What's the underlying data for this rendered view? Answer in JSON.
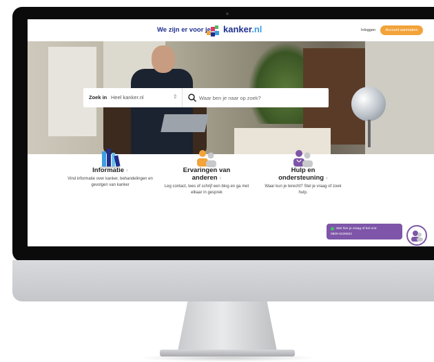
{
  "header": {
    "tagline": "We zijn er voor je…",
    "brand_name": "kanker",
    "brand_tld": ".nl",
    "login_label": "Inloggen",
    "account_label": "Account aanmaken"
  },
  "search": {
    "label": "Zoek in",
    "scope": "Heel kanker.nl",
    "placeholder": "Waar ben je naar op zoek?"
  },
  "features": [
    {
      "icon": "books-icon",
      "title": "Informatie",
      "title2": "",
      "description": "Vind informatie over kanker, behandelingen en gevolgen van kanker"
    },
    {
      "icon": "people-icon",
      "title": "Ervaringen van",
      "title2": "anderen",
      "description": "Leg contact, lees of schrijf een blog en ga met elkaar in gesprek"
    },
    {
      "icon": "doctor-icon",
      "title": "Hulp en",
      "title2": "ondersteuning",
      "description": "Waar kun je terecht? Stel je vraag of zoek hulp."
    }
  ],
  "chat": {
    "line1": "Stel hier je vraag of bel ons:",
    "line2": "0800-0226622"
  },
  "colors": {
    "brand_blue": "#1e2f8f",
    "accent_orange": "#f2a33a",
    "chat_purple": "#7e55a8"
  }
}
